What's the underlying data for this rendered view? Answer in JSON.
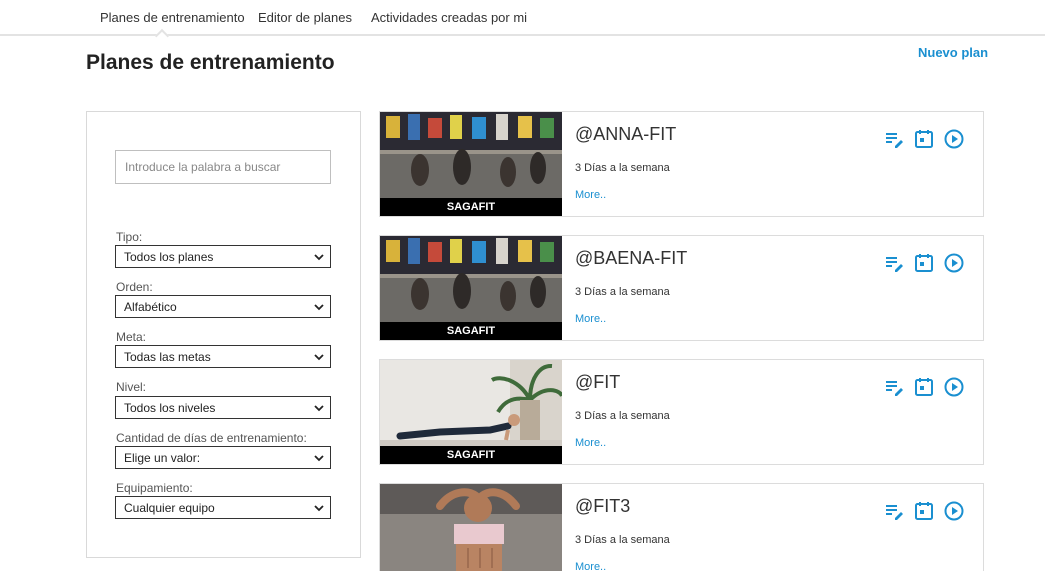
{
  "nav": {
    "tabs": [
      {
        "label": "Planes de entrenamiento"
      },
      {
        "label": "Editor de planes"
      },
      {
        "label": "Actividades creadas por mi"
      }
    ]
  },
  "header": {
    "title": "Planes de entrenamiento",
    "new_plan_label": "Nuevo plan"
  },
  "colors": {
    "accent": "#1a8fd0",
    "thumb_bar": "#000000"
  },
  "filters": {
    "search_placeholder": "Introduce la palabra a buscar",
    "items": [
      {
        "label": "Tipo:",
        "value": "Todos los planes"
      },
      {
        "label": "Orden:",
        "value": "Alfabético"
      },
      {
        "label": "Meta:",
        "value": "Todas las metas"
      },
      {
        "label": "Nivel:",
        "value": "Todos los niveles"
      },
      {
        "label": "Cantidad de días de entrenamiento:",
        "value": "Elige un valor:"
      },
      {
        "label": "Equipamiento:",
        "value": "Cualquier equipo"
      }
    ]
  },
  "plans": [
    {
      "title": "@ANNA-FIT",
      "days": "3 Días a la semana",
      "more": "More..",
      "brand": "SAGAFIT",
      "image": "obstacle-race-photo"
    },
    {
      "title": "@BAENA-FIT",
      "days": "3 Días a la semana",
      "more": "More..",
      "brand": "SAGAFIT",
      "image": "obstacle-race-photo"
    },
    {
      "title": "@FIT",
      "days": "3 Días a la semana",
      "more": "More..",
      "brand": "SAGAFIT",
      "image": "plank-exercise-photo"
    },
    {
      "title": "@FIT3",
      "days": "3 Días a la semana",
      "more": "More..",
      "brand": "",
      "image": "situp-exercise-photo"
    }
  ],
  "icons": [
    "edit-list-icon",
    "calendar-icon",
    "play-icon"
  ]
}
